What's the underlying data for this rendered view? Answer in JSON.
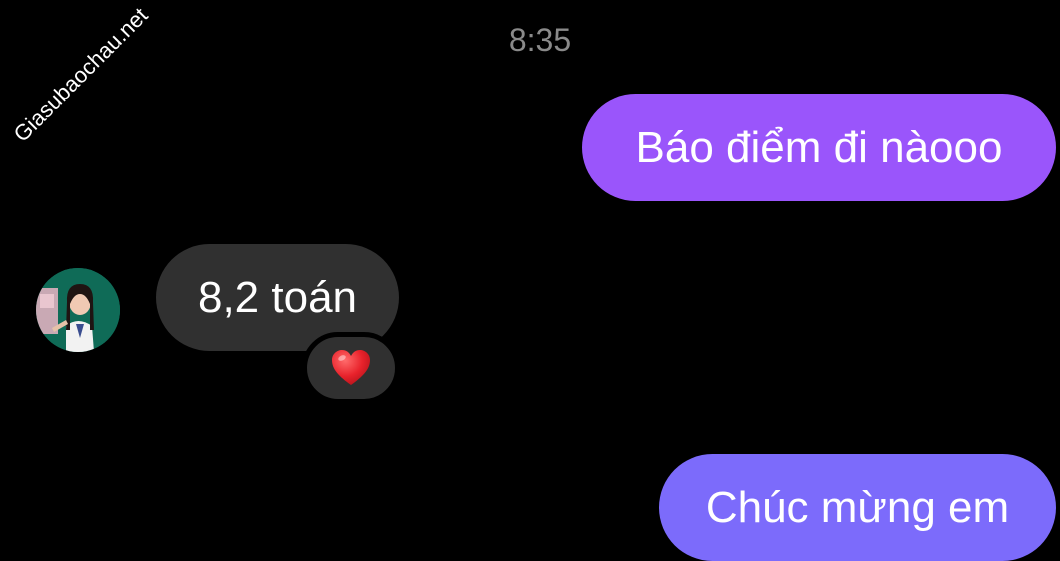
{
  "watermark": "Giasubaochau.net",
  "chat": {
    "timestamp": "8:35",
    "messages": [
      {
        "direction": "outgoing",
        "text": "Báo điểm đi nàooo"
      },
      {
        "direction": "incoming",
        "text": "8,2 toán",
        "reaction": "heart"
      },
      {
        "direction": "outgoing",
        "text": "Chúc mừng em"
      }
    ]
  },
  "colors": {
    "background": "#000000",
    "outgoing_bubble_1": "#9a55fb",
    "outgoing_bubble_2": "#7c6bfb",
    "incoming_bubble": "#303030",
    "timestamp": "#8a8a8a",
    "reaction_heart": "#e8222b"
  },
  "icons": {
    "reaction": "heart-icon",
    "avatar": "contact-avatar"
  }
}
